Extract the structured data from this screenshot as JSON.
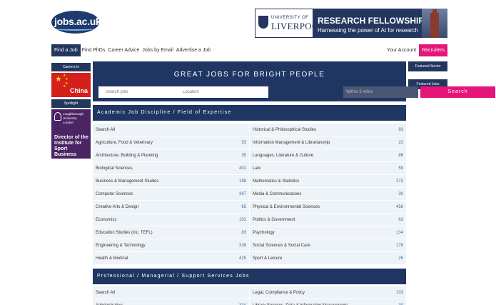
{
  "logo": {
    "text": "jobs.ac.uk"
  },
  "banner": {
    "university_small": "UNIVERSITY OF",
    "university_big": "LIVERPOOL",
    "title": "RESEARCH FELLOWSHIPS",
    "subtitle": "Harnessing the power of AI for research"
  },
  "nav": {
    "items": [
      "Find a Job",
      "Find PhDs",
      "Career Advice",
      "Jobs by Email",
      "Advertise a Job"
    ],
    "account": "Your Account",
    "recruiters": "Recruiters"
  },
  "left_sidebar": {
    "careers_in": "Careers In",
    "china": "China",
    "spotlight": "Spotlight",
    "lboro_name": [
      "Loughborough",
      "University",
      "London"
    ],
    "lboro_text": [
      "Director of the",
      "Institute for",
      "Sport Business"
    ]
  },
  "right_sidebar": {
    "featured_sector": "Featured Sector",
    "featured_jobs": "Featured Jobs"
  },
  "hero": {
    "title": "GREAT JOBS FOR BRIGHT PEOPLE",
    "search_placeholder": "Search jobs",
    "location_placeholder": "Location",
    "within_label": "Within 5 miles",
    "search_button": "Search"
  },
  "academic": {
    "title": "Academic Job Discipline / Field of Expertise",
    "left": [
      {
        "label": "Search All",
        "count": ""
      },
      {
        "label": "Agriculture, Food & Veterinary",
        "count": "53"
      },
      {
        "label": "Architecture, Building & Planning",
        "count": "35"
      },
      {
        "label": "Biological Sciences",
        "count": "401"
      },
      {
        "label": "Business & Management Studies",
        "count": "198"
      },
      {
        "label": "Computer Sciences",
        "count": "397"
      },
      {
        "label": "Creative Arts & Design",
        "count": "65"
      },
      {
        "label": "Economics",
        "count": "102"
      },
      {
        "label": "Education Studies (inc. TEFL)",
        "count": "83"
      },
      {
        "label": "Engineering & Technology",
        "count": "338"
      },
      {
        "label": "Health & Medical",
        "count": "425"
      }
    ],
    "right": [
      {
        "label": "Historical & Philosophical Studies",
        "count": "93"
      },
      {
        "label": "Information Management & Librarianship",
        "count": "23"
      },
      {
        "label": "Languages, Literature & Culture",
        "count": "86"
      },
      {
        "label": "Law",
        "count": "59"
      },
      {
        "label": "Mathematics & Statistics",
        "count": "273"
      },
      {
        "label": "Media & Communications",
        "count": "30"
      },
      {
        "label": "Physical & Environmental Sciences",
        "count": "456"
      },
      {
        "label": "Politics & Government",
        "count": "63"
      },
      {
        "label": "Psychology",
        "count": "134"
      },
      {
        "label": "Social Sciences & Social Care",
        "count": "178"
      },
      {
        "label": "Sport & Leisure",
        "count": "26"
      }
    ]
  },
  "professional": {
    "title": "Professional / Managerial / Support Services Jobs",
    "left": [
      {
        "label": "Search All",
        "count": ""
      },
      {
        "label": "Administrative",
        "count": "334"
      }
    ],
    "right": [
      {
        "label": "Legal, Compliance & Policy",
        "count": "103"
      },
      {
        "label": "Library Services, Data & Information Management",
        "count": "30"
      }
    ]
  }
}
